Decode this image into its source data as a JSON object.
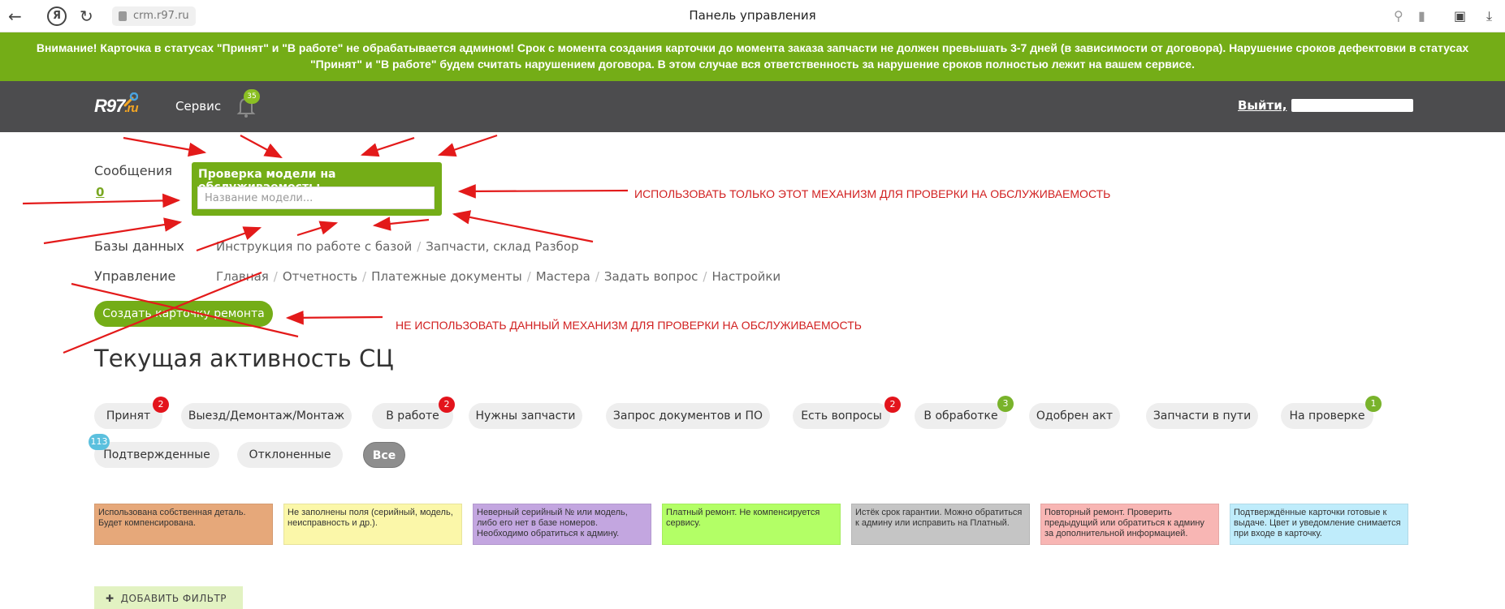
{
  "browser": {
    "back_icon": "←",
    "yandex_icon": "Я",
    "reload_icon": "↻",
    "url": "crm.r97.ru",
    "title": "Панель управления"
  },
  "warning": {
    "line1": "Внимание! Карточка в статусах \"Принят\" и \"В работе\" не обрабатывается админом! Срок с момента создания карточки до момента заказа запчасти не должен превышать 3-7 дней (в зависимости от договора). Нарушение сроков дефектовки в статусах",
    "line2": "\"Принят\" и \"В работе\" будем считать нарушением договора. В этом случае вся ответственность за нарушение сроков полностью лежит на вашем сервисе."
  },
  "header": {
    "logo_main": "R97",
    "logo_suffix": ".ru",
    "service_label": "Сервис",
    "notifications_count": "35",
    "logout_label": "Выйти,"
  },
  "messages": {
    "label": "Сообщения",
    "count": "0"
  },
  "model_check": {
    "title": "Проверка модели на обслуживаемость:",
    "placeholder": "Название модели..."
  },
  "databases": {
    "label": "Базы данных",
    "links": [
      "Инструкция по работе с базой",
      "Запчасти, склад Разбор"
    ]
  },
  "management": {
    "label": "Управление",
    "links": [
      "Главная",
      "Отчетность",
      "Платежные документы",
      "Мастера",
      "Задать вопрос",
      "Настройки"
    ]
  },
  "create_button": "Создать карточку ремонта",
  "annotations": {
    "use_only": "ИСПОЛЬЗОВАТЬ ТОЛЬКО ЭТОТ МЕХАНИЗМ ДЛЯ ПРОВЕРКИ НА ОБСЛУЖИВАЕМОСТЬ",
    "do_not_use": "НЕ ИСПОЛЬЗОВАТЬ ДАННЫЙ МЕХАНИЗМ ДЛЯ ПРОВЕРКИ НА ОБСЛУЖИВАЕМОСТЬ"
  },
  "activity_title": "Текущая активность СЦ",
  "statuses": [
    {
      "label": "Принят",
      "badge": "2",
      "badge_color": "red"
    },
    {
      "label": "Выезд/Демонтаж/Монтаж",
      "badge": ""
    },
    {
      "label": "В работе",
      "badge": "2",
      "badge_color": "red"
    },
    {
      "label": "Нужны запчасти",
      "badge": ""
    },
    {
      "label": "Запрос документов и ПО",
      "badge": ""
    },
    {
      "label": "Есть вопросы",
      "badge": "2",
      "badge_color": "red"
    },
    {
      "label": "В обработке",
      "badge": "3",
      "badge_color": "green"
    },
    {
      "label": "Одобрен акт",
      "badge": ""
    },
    {
      "label": "Запчасти в пути",
      "badge": ""
    },
    {
      "label": "На проверке",
      "badge": "1",
      "badge_color": "green"
    },
    {
      "label": "Подтвержденные",
      "badge": "113",
      "badge_color": "blue"
    },
    {
      "label": "Отклоненные",
      "badge": ""
    },
    {
      "label": "Все",
      "badge": "",
      "active": true
    }
  ],
  "legend": [
    {
      "text": "Использована собственная деталь. Будет компенсирована.",
      "color": "#e6a87a"
    },
    {
      "text": "Не заполнены поля (серийный, модель, неисправность и др.).",
      "color": "#fbf7a9"
    },
    {
      "text": "Неверный серийный № или модель, либо его нет в базе номеров. Необходимо обратиться к админу.",
      "color": "#c3a6e0"
    },
    {
      "text": "Платный ремонт. Не компенсируется сервису.",
      "color": "#b3ff66"
    },
    {
      "text": "Истёк срок гарантии. Можно обратиться к админу или исправить на Платный.",
      "color": "#c5c5c5"
    },
    {
      "text": "Повторный ремонт. Проверить предыдущий или обратиться к админу за дополнительной информацией.",
      "color": "#f8b6b4"
    },
    {
      "text": "Подтверждённые карточки готовые к выдаче. Цвет и уведомление снимается при входе в карточку.",
      "color": "#bfecfb"
    }
  ],
  "add_filter": "ДОБАВИТЬ ФИЛЬТР"
}
